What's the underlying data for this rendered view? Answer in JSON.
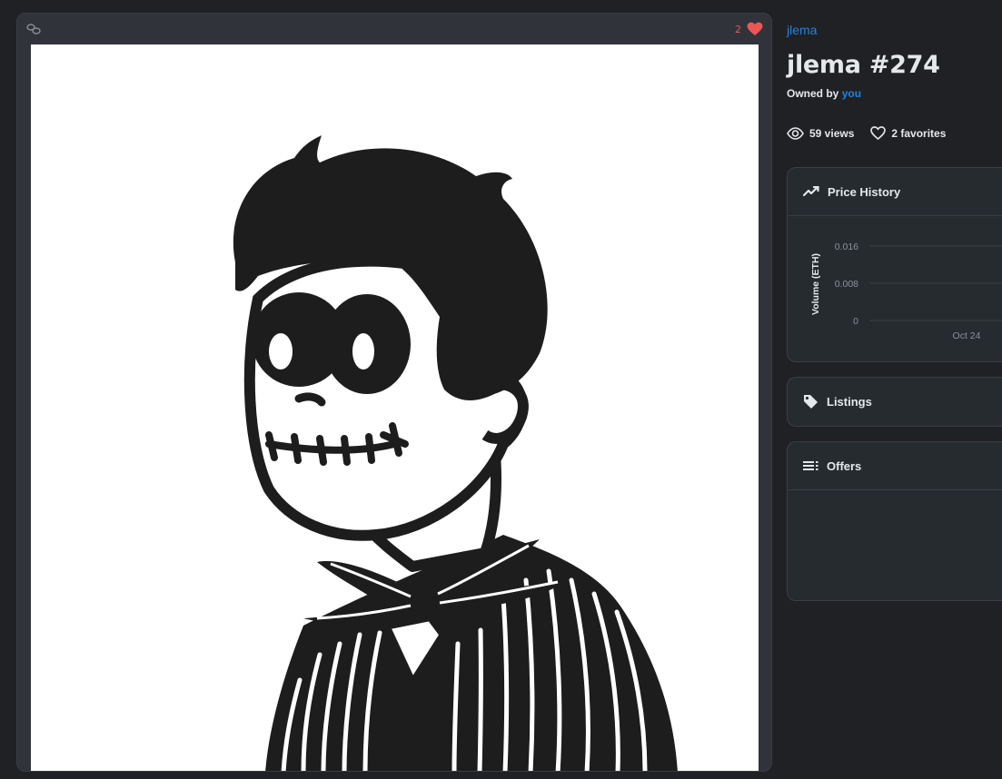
{
  "media": {
    "favorite_count": "2",
    "chain_icon": "link-icon",
    "heart_icon": "heart-icon",
    "heart_color": "#eb5757"
  },
  "item": {
    "collection": "jlema",
    "title": "jlema #274",
    "owned_prefix": "Owned by",
    "owner": "you",
    "views": "59 views",
    "favorites": "2 favorites"
  },
  "price_history": {
    "label": "Price History",
    "icon": "trend-line-icon"
  },
  "listings": {
    "label": "Listings",
    "icon": "tag-icon"
  },
  "offers": {
    "label": "Offers",
    "icon": "list-icon"
  },
  "colors": {
    "accent": "#2081e2",
    "panel_bg": "#262b2f",
    "page_bg": "#202124"
  },
  "chart_data": {
    "type": "line",
    "title": "",
    "xlabel": "",
    "ylabel": "Volume (ETH)",
    "y_ticks": [
      "0.016",
      "0.008",
      "0"
    ],
    "x_ticks": [
      "Oct 24"
    ],
    "ylim": [
      0,
      0.016
    ],
    "grid": true,
    "series": []
  }
}
